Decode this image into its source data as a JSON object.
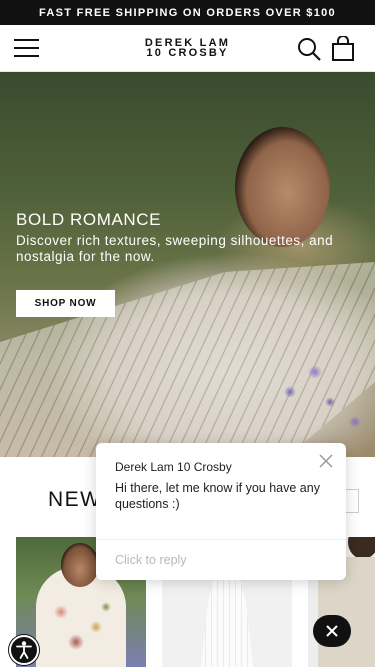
{
  "announcement": {
    "text": "FAST FREE SHIPPING ON ORDERS OVER $100"
  },
  "header": {
    "logo_line1": "DEREK LAM",
    "logo_line2": "10 CROSBY",
    "icons": [
      "hamburger-menu-icon",
      "search-icon",
      "shopping-bag-icon"
    ]
  },
  "hero": {
    "title": "BOLD ROMANCE",
    "subtitle": "Discover rich textures, sweeping silhouettes, and nostalgia for the now.",
    "cta_label": "SHOP NOW"
  },
  "new_arrivals": {
    "title": "NEW"
  },
  "chat": {
    "brand_name": "Derek Lam 10 Crosby",
    "message": "Hi there, let me know if you have any questions :)",
    "reply_placeholder": "Click to reply"
  },
  "colors": {
    "text": "#111111",
    "bar": "#111111",
    "reply_placeholder": "#b8b8b8"
  }
}
